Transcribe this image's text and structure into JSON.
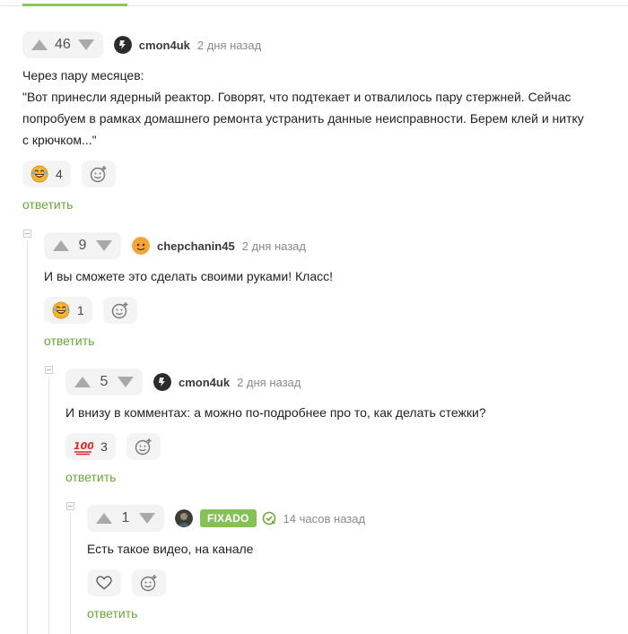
{
  "colors": {
    "accent": "#6aa73a",
    "badge": "#86c158",
    "rating_bg": "#f3f3f3"
  },
  "comments": [
    {
      "rating": "46",
      "author": "cmon4uk",
      "time": "2 дня назад",
      "text_lines": [
        "Через пару месяцев:",
        "\"Вот принесли ядерный реактор. Говорят, что подтекает и отвалилось пару стержней. Сейчас",
        "попробуем в рамках домашнего ремонта устранить данные неисправности. Берем клей и нитку",
        "с крючком...\""
      ],
      "reaction": {
        "icon": "laughing-face-icon",
        "count": "4"
      },
      "reply": "ответить"
    },
    {
      "rating": "9",
      "author": "chepchanin45",
      "time": "2 дня назад",
      "text_lines": [
        "И вы сможете это сделать своими руками! Класс!"
      ],
      "reaction": {
        "icon": "laughing-face-icon",
        "count": "1"
      },
      "reply": "ответить"
    },
    {
      "rating": "5",
      "author": "cmon4uk",
      "time": "2 дня назад",
      "text_lines": [
        "И внизу в комментах: а можно по-подробнее про то, как делать стежки?"
      ],
      "reaction": {
        "icon": "hundred-points-icon",
        "count": "3"
      },
      "reply": "ответить"
    },
    {
      "rating": "1",
      "author": "FIXADO",
      "time": "14 часов назад",
      "text_lines": [
        "Есть такое видео, на канале"
      ],
      "reaction": {
        "icon": "heart-icon",
        "count": ""
      },
      "reply": "ответить"
    }
  ]
}
